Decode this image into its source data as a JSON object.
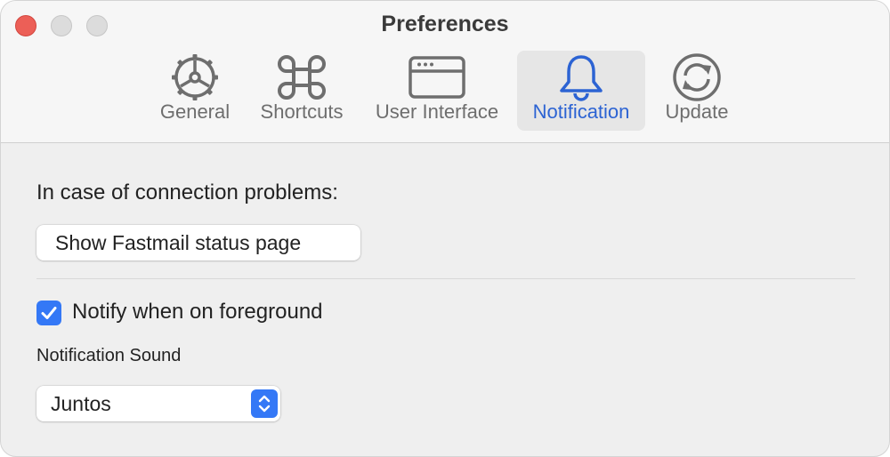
{
  "window": {
    "title": "Preferences"
  },
  "tabs": [
    {
      "label": "General",
      "icon": "gear-icon"
    },
    {
      "label": "Shortcuts",
      "icon": "command-key-icon"
    },
    {
      "label": "User Interface",
      "icon": "window-icon"
    },
    {
      "label": "Notification",
      "icon": "bell-icon",
      "active": true
    },
    {
      "label": "Update",
      "icon": "refresh-icon"
    }
  ],
  "notification": {
    "connection_heading": "In case of connection problems:",
    "status_button_label": "Show Fastmail status page",
    "notify_checkbox_label": "Notify when on foreground",
    "notify_checked": true,
    "sound_label": "Notification Sound",
    "sound_value": "Juntos"
  },
  "colors": {
    "accent": "#3478f6",
    "active_tab_text": "#2c63d3",
    "close_button": "#ec5f57"
  }
}
